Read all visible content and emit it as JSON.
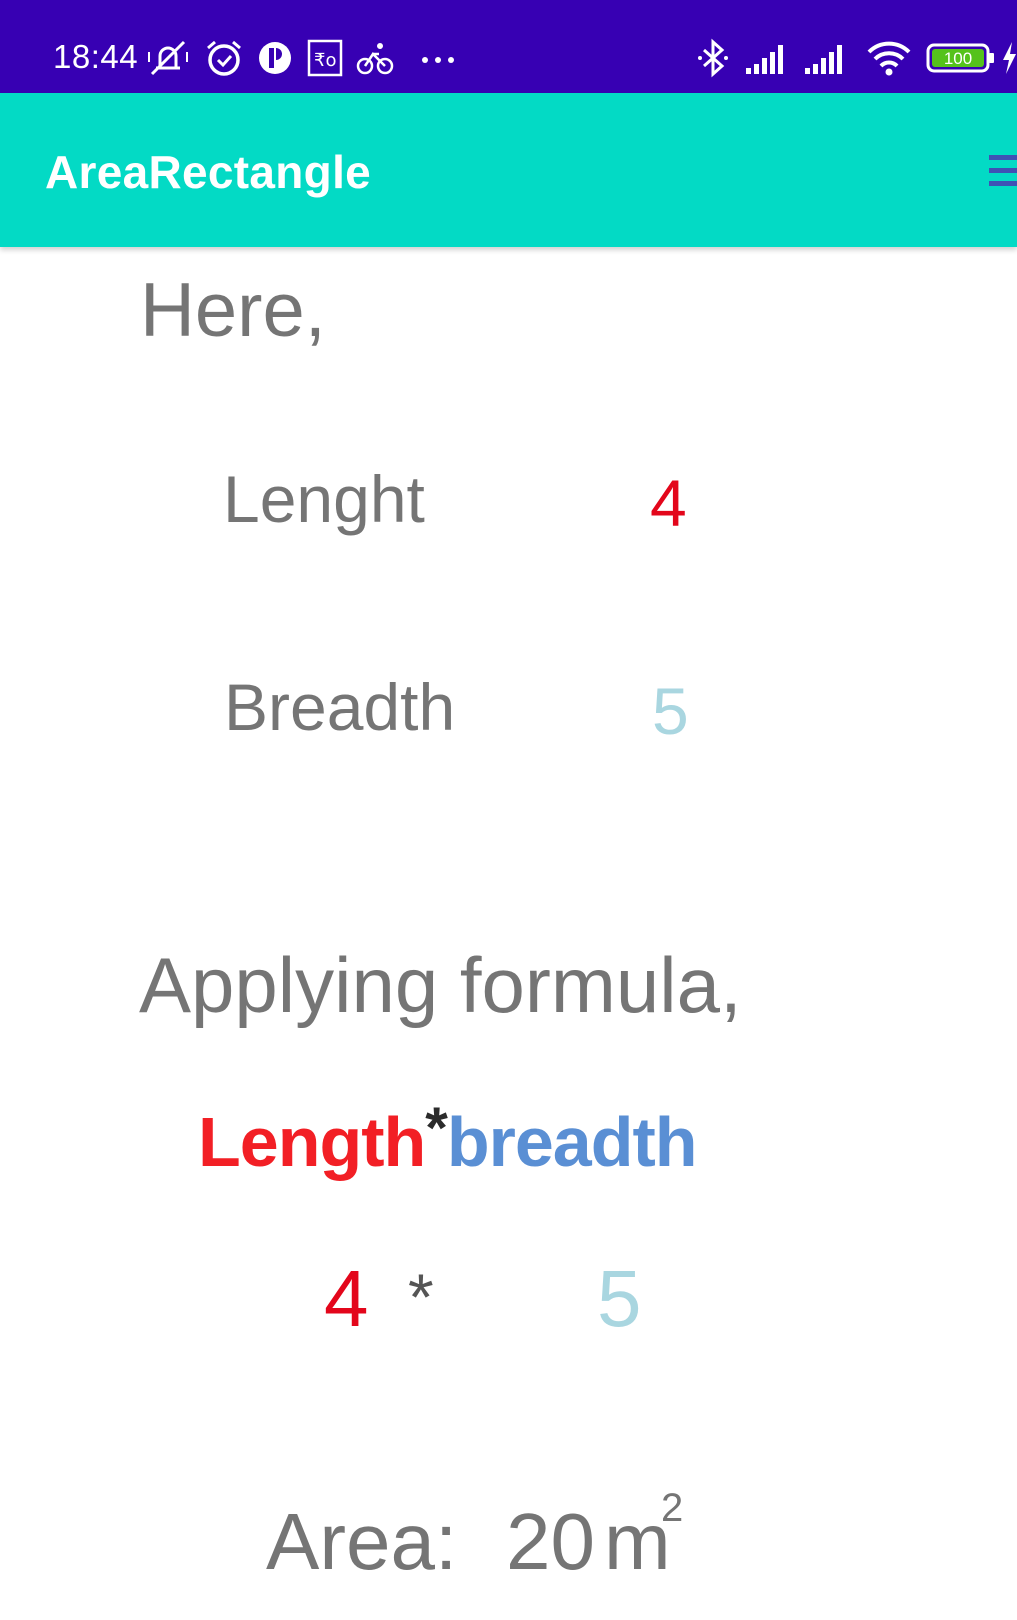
{
  "status_bar": {
    "time": "18:44",
    "battery": "100",
    "icons": [
      "mute-icon",
      "alarm-icon",
      "app-notification-icon",
      "rupee-icon",
      "cycling-icon",
      "more-notifications-icon",
      "bluetooth-icon",
      "signal-icon",
      "signal-icon",
      "wifi-icon",
      "battery-icon",
      "charging-icon"
    ]
  },
  "app_bar": {
    "title": "AreaRectangle",
    "menu_icon": "menu-icon"
  },
  "content": {
    "here_label": "Here,",
    "length_label": "Lenght",
    "length_value": "4",
    "breadth_label": "Breadth",
    "breadth_value": "5",
    "applying_label": "Applying formula,",
    "formula": {
      "length_part": "Length",
      "operator": "*",
      "breadth_part": "breadth"
    },
    "substitution": {
      "length_value": "4",
      "operator": "*",
      "breadth_value": "5"
    },
    "area": {
      "label": "Area:",
      "value": "20",
      "unit": "m",
      "exponent": "2"
    }
  },
  "colors": {
    "status_bar": "#3700b3",
    "app_bar": "#03dac5",
    "text_gray": "#757575",
    "length_red": "#e3061b",
    "breadth_lightblue": "#a9d6e0",
    "formula_blue": "#5a8fd4"
  }
}
